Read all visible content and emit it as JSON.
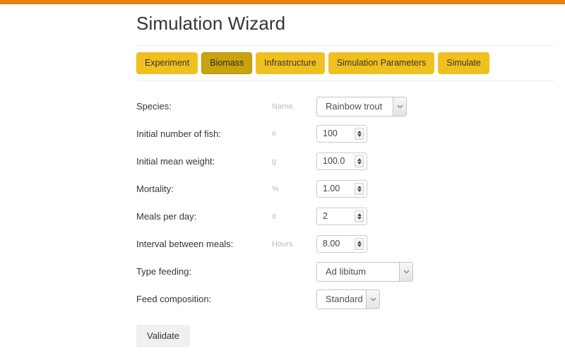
{
  "theme": {
    "topbar_color": "#e8820c",
    "tab_color": "#f0c020",
    "tab_active_color": "#c9a210",
    "button_color": "#f0f0f0"
  },
  "header": {
    "title": "Simulation Wizard"
  },
  "tabs": [
    {
      "label": "Experiment",
      "active": false
    },
    {
      "label": "Biomass",
      "active": true
    },
    {
      "label": "Infrastructure",
      "active": false
    },
    {
      "label": "Simulation Parameters",
      "active": false
    },
    {
      "label": "Simulate",
      "active": false
    }
  ],
  "form": {
    "rows": [
      {
        "label": "Species:",
        "unit": "Name",
        "control": "select",
        "value": "Rainbow trout"
      },
      {
        "label": "Initial number of fish:",
        "unit": "#",
        "control": "spinner",
        "value": "100"
      },
      {
        "label": "Initial mean weight:",
        "unit": "g",
        "control": "spinner",
        "value": "100.0"
      },
      {
        "label": "Mortality:",
        "unit": "%",
        "control": "spinner",
        "value": "1.00"
      },
      {
        "label": "Meals per day:",
        "unit": "#",
        "control": "spinner",
        "value": "2"
      },
      {
        "label": "Interval between meals:",
        "unit": "Hours",
        "control": "spinner",
        "value": "8.00"
      },
      {
        "label": "Type feeding:",
        "unit": "",
        "control": "select",
        "value": "Ad libitum"
      },
      {
        "label": "Feed composition:",
        "unit": "",
        "control": "select",
        "value": "Standard"
      }
    ]
  },
  "actions": {
    "validate_label": "Validate"
  },
  "icons": {
    "spinner_up": "triangle-up-icon",
    "spinner_down": "triangle-down-icon",
    "select_chevron": "chevron-down-icon"
  }
}
